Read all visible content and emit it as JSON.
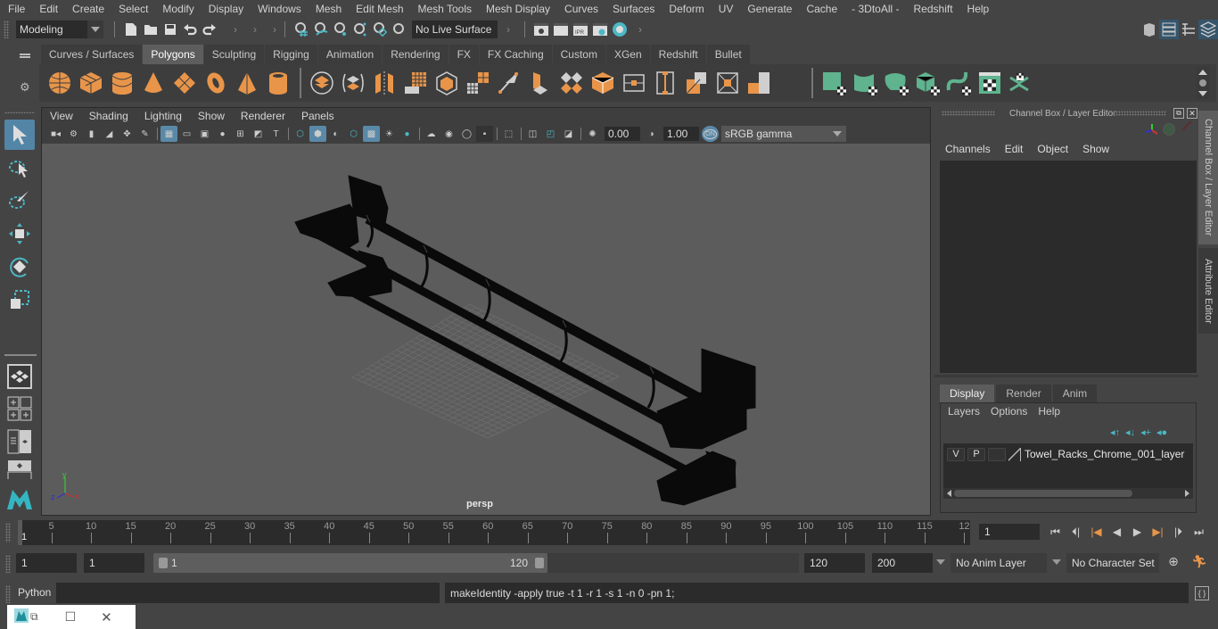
{
  "menubar": {
    "items": [
      "File",
      "Edit",
      "Create",
      "Select",
      "Modify",
      "Display",
      "Windows",
      "Mesh",
      "Edit Mesh",
      "Mesh Tools",
      "Mesh Display",
      "Curves",
      "Surfaces",
      "Deform",
      "UV",
      "Generate",
      "Cache",
      "- 3DtoAll -",
      "Redshift",
      "Help"
    ]
  },
  "statusline": {
    "mode": "Modeling",
    "live_surface": "No Live Surface"
  },
  "shelf": {
    "tabs": [
      "Curves / Surfaces",
      "Polygons",
      "Sculpting",
      "Rigging",
      "Animation",
      "Rendering",
      "FX",
      "FX Caching",
      "Custom",
      "XGen",
      "Redshift",
      "Bullet"
    ],
    "active_tab": "Polygons",
    "icons_primitives": [
      "poly-sphere-icon",
      "poly-cube-icon",
      "poly-cylinder-icon",
      "poly-cone-icon",
      "poly-plane-icon",
      "poly-torus-icon",
      "poly-pyramid-icon",
      "poly-pipe-icon"
    ],
    "icons_tools": [
      "combine-icon",
      "separate-icon",
      "mirror-icon",
      "smooth-icon",
      "extrude-icon",
      "bridge-icon",
      "bevel-icon",
      "multicut-icon",
      "extrude-face-icon",
      "target-weld-icon",
      "bevel-cube-icon",
      "edge-loop-icon",
      "insert-edge-loop-icon",
      "unfold-icon",
      "quad-draw-icon",
      "fill-hole-icon"
    ],
    "icons_uv": [
      "planar-map-icon",
      "cylindrical-map-icon",
      "spherical-map-icon",
      "auto-map-icon",
      "uv-sew-icon",
      "uv-editor-icon",
      "uv-unfold-icon"
    ]
  },
  "viewport": {
    "menu": [
      "View",
      "Shading",
      "Lighting",
      "Show",
      "Renderer",
      "Panels"
    ],
    "exposure": "0.00",
    "gamma": "1.00",
    "color_space": "sRGB gamma",
    "color_mgmt": "ON",
    "camera_label": "persp",
    "axis": {
      "x": "x",
      "y": "y",
      "z": "z"
    }
  },
  "channel_box": {
    "title": "Channel Box / Layer Editor",
    "menu": [
      "Channels",
      "Edit",
      "Object",
      "Show"
    ]
  },
  "layer_editor": {
    "tabs": [
      "Display",
      "Render",
      "Anim"
    ],
    "active_tab": "Display",
    "menu": [
      "Layers",
      "Options",
      "Help"
    ],
    "layers": [
      {
        "v": "V",
        "p": "P",
        "name": "Towel_Racks_Chrome_001_layer"
      }
    ]
  },
  "side_tabs": [
    "Channel Box / Layer Editor",
    "Attribute Editor"
  ],
  "timeslider": {
    "ticks": [
      5,
      10,
      15,
      20,
      25,
      30,
      35,
      40,
      45,
      50,
      55,
      60,
      65,
      70,
      75,
      80,
      85,
      90,
      95,
      100,
      105,
      110,
      115,
      "12"
    ],
    "start": 1,
    "end": 120,
    "current_frame_label": "1",
    "current_frame": "1"
  },
  "range": {
    "start_time": "1",
    "playback_start": "1",
    "range_min_label": "1",
    "range_max_label": "120",
    "playback_end": "120",
    "end_time": "200",
    "anim_layer": "No Anim Layer",
    "character_set": "No Character Set"
  },
  "cmdline": {
    "language": "Python",
    "input": "",
    "result": "makeIdentity -apply true -t 1 -r 1 -s 1 -n 0 -pn 1;"
  },
  "colors": {
    "accent": "#5285a6",
    "shelf_orange": "#e8954a",
    "shelf_green": "#5fb38e",
    "viewport_bg": "#5c5c5c"
  }
}
